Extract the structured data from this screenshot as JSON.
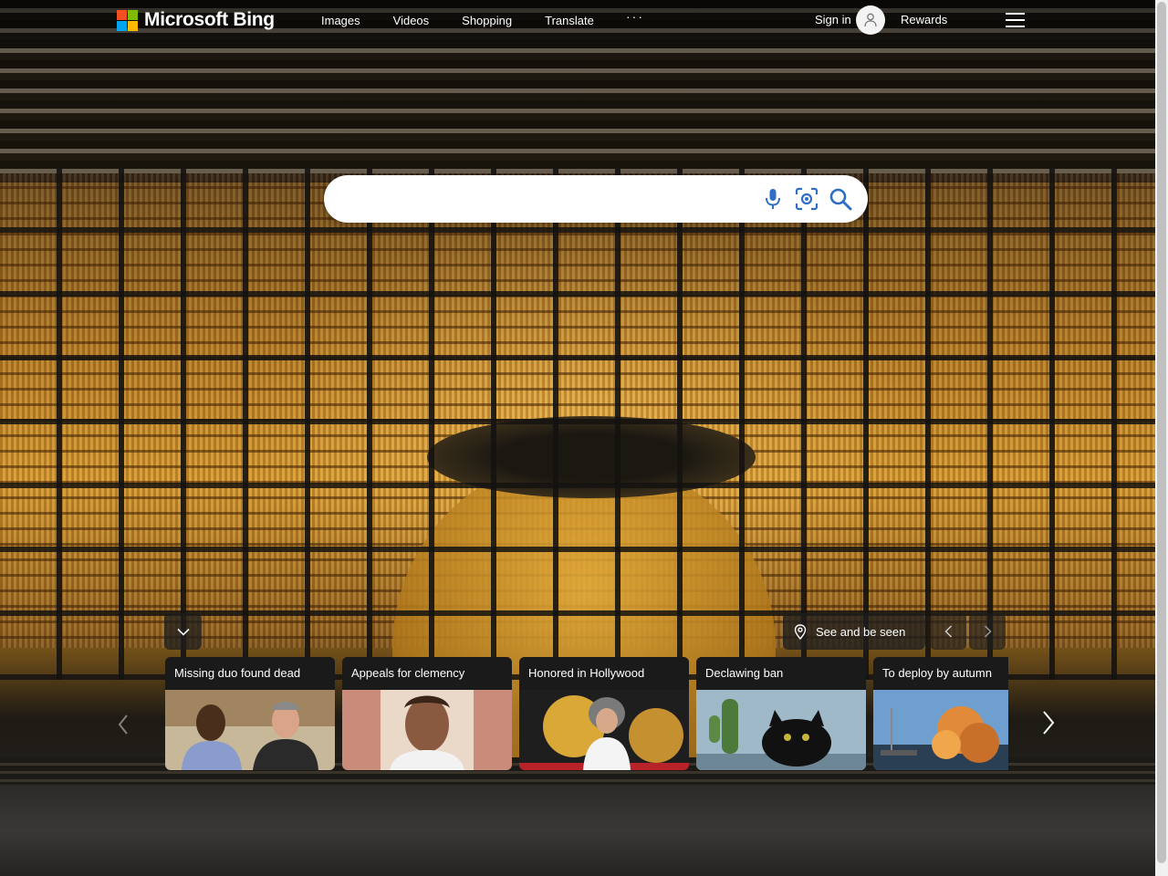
{
  "brand": {
    "name": "Microsoft Bing",
    "logo_colors": [
      "#f25022",
      "#7fba00",
      "#00a4ef",
      "#ffb900"
    ]
  },
  "nav": {
    "items": [
      {
        "label": "Images"
      },
      {
        "label": "Videos"
      },
      {
        "label": "Shopping"
      },
      {
        "label": "Translate"
      }
    ],
    "more": "···"
  },
  "account": {
    "signin_label": "Sign in",
    "avatar_icon": "person-icon",
    "rewards_label": "Rewards",
    "menu_icon": "hamburger-icon"
  },
  "search": {
    "value": "",
    "placeholder": "",
    "icons": [
      "mic-icon",
      "visual-search-icon",
      "search-icon"
    ]
  },
  "image_of_day": {
    "label": "See and be seen",
    "icon": "location-pin-icon"
  },
  "news": {
    "cards": [
      {
        "title": "Missing duo found dead"
      },
      {
        "title": "Appeals for clemency"
      },
      {
        "title": "Honored in Hollywood"
      },
      {
        "title": "Declawing ban"
      },
      {
        "title": "To deploy by autumn"
      }
    ]
  }
}
